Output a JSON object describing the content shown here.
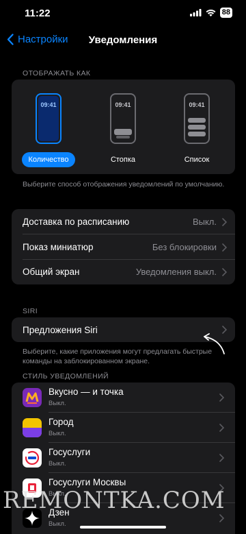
{
  "status": {
    "time": "11:22",
    "battery": "88"
  },
  "nav": {
    "back_label": "Настройки",
    "title": "Уведомления"
  },
  "display": {
    "header": "ОТОБРАЖАТЬ КАК",
    "options": [
      {
        "label": "Количество",
        "phone_time": "09:41",
        "selected": true
      },
      {
        "label": "Стопка",
        "phone_time": "09:41",
        "selected": false
      },
      {
        "label": "Список",
        "phone_time": "09:41",
        "selected": false
      }
    ],
    "footnote": "Выберите способ отображения уведомлений по умолчанию."
  },
  "settings": {
    "rows": [
      {
        "label": "Доставка по расписанию",
        "value": "Выкл."
      },
      {
        "label": "Показ миниатюр",
        "value": "Без блокировки"
      },
      {
        "label": "Общий экран",
        "value": "Уведомления выкл."
      }
    ]
  },
  "siri": {
    "header": "SIRI",
    "row_label": "Предложения Siri",
    "footnote": "Выберите, какие приложения могут предлагать быстрые команды на заблокированном экране."
  },
  "apps": {
    "header": "СТИЛЬ УВЕДОМЛЕНИЙ",
    "items": [
      {
        "name": "Вкусно — и точка",
        "status": "Выкл.",
        "icon": "vkusno-icon"
      },
      {
        "name": "Город",
        "status": "Выкл.",
        "icon": "gorod-icon"
      },
      {
        "name": "Госуслуги",
        "status": "Выкл.",
        "icon": "gosuslugi-icon"
      },
      {
        "name": "Госуслуги  Москвы",
        "status": "Выкл.",
        "icon": "gosuslugi-moscow-icon"
      },
      {
        "name": "Дзен",
        "status": "Выкл.",
        "icon": "dzen-icon"
      }
    ]
  },
  "watermark": "REMONTKA.COM",
  "colors": {
    "accent": "#0a84ff",
    "card": "#1c1c1e",
    "secondary_text": "#8d8d93"
  }
}
